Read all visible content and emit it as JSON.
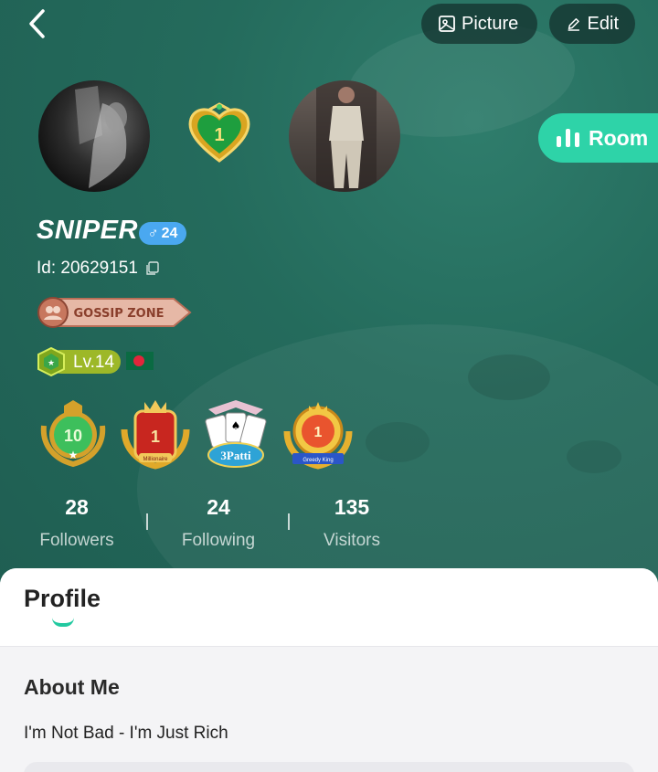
{
  "header": {
    "picture_label": "Picture",
    "edit_label": "Edit"
  },
  "room": {
    "label": "Room"
  },
  "level_heart": {
    "number": "1"
  },
  "user": {
    "name": "SNIPER",
    "gender_symbol": "♂",
    "age": "24",
    "id_text": "Id: 20629151",
    "gossip_label": "GOSSIP ZONE",
    "level": "Lv.14",
    "medals": [
      {
        "name": "level-10-medal",
        "text": "10"
      },
      {
        "name": "millionaire-medal",
        "text": "Millionaire"
      },
      {
        "name": "3patti-medal",
        "text": "3Patti"
      },
      {
        "name": "greedy-king-medal",
        "text": "Greedy King"
      }
    ]
  },
  "stats": [
    {
      "value": "28",
      "label": "Followers"
    },
    {
      "value": "24",
      "label": "Following"
    },
    {
      "value": "135",
      "label": "Visitors"
    }
  ],
  "tabs": {
    "profile": "Profile"
  },
  "about": {
    "title": "About Me",
    "text": "I'm Not Bad - I'm Just Rich"
  },
  "colors": {
    "hero_bg": "#246b5c",
    "accent": "#2ed3a8",
    "gender_badge": "#4aa8f0"
  }
}
